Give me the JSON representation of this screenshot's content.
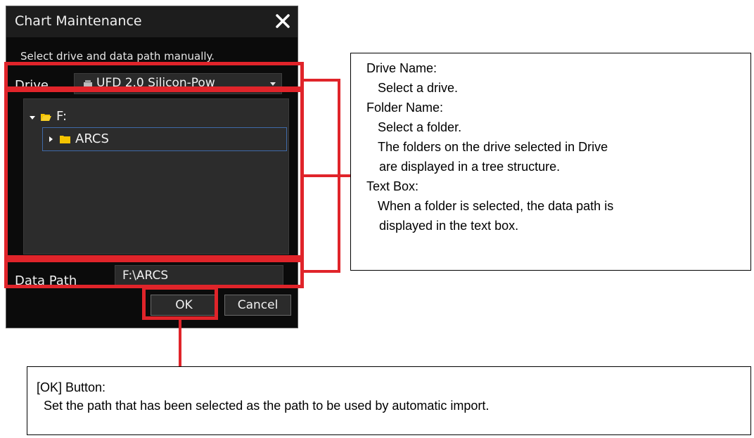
{
  "dialog": {
    "title": "Chart Maintenance",
    "subtitle": "Select drive and data path manually.",
    "drive_label": "Drive",
    "drive_value": "UFD 2.0 Silicon-Pow",
    "tree": {
      "root_label": "F:",
      "child_label": "ARCS"
    },
    "path_label": "Data Path",
    "path_value": "F:\\ARCS",
    "ok_label": "OK",
    "cancel_label": "Cancel"
  },
  "callout_right": {
    "lines": [
      "Drive Name:",
      "  Select a drive.",
      "Folder Name:",
      "  Select a folder.",
      "  The folders on the drive selected in Drive",
      "   are displayed in a tree structure.",
      "Text Box:",
      "  When a folder is selected, the data path is",
      "   displayed in the text box."
    ]
  },
  "callout_bottom": {
    "lines": [
      "[OK] Button:",
      "  Set the path that has been selected as the path to be used by automatic import."
    ]
  },
  "colors": {
    "highlight": "#e0242a",
    "dialog_bg": "#0b0b0b",
    "folder": "#f5c400"
  }
}
